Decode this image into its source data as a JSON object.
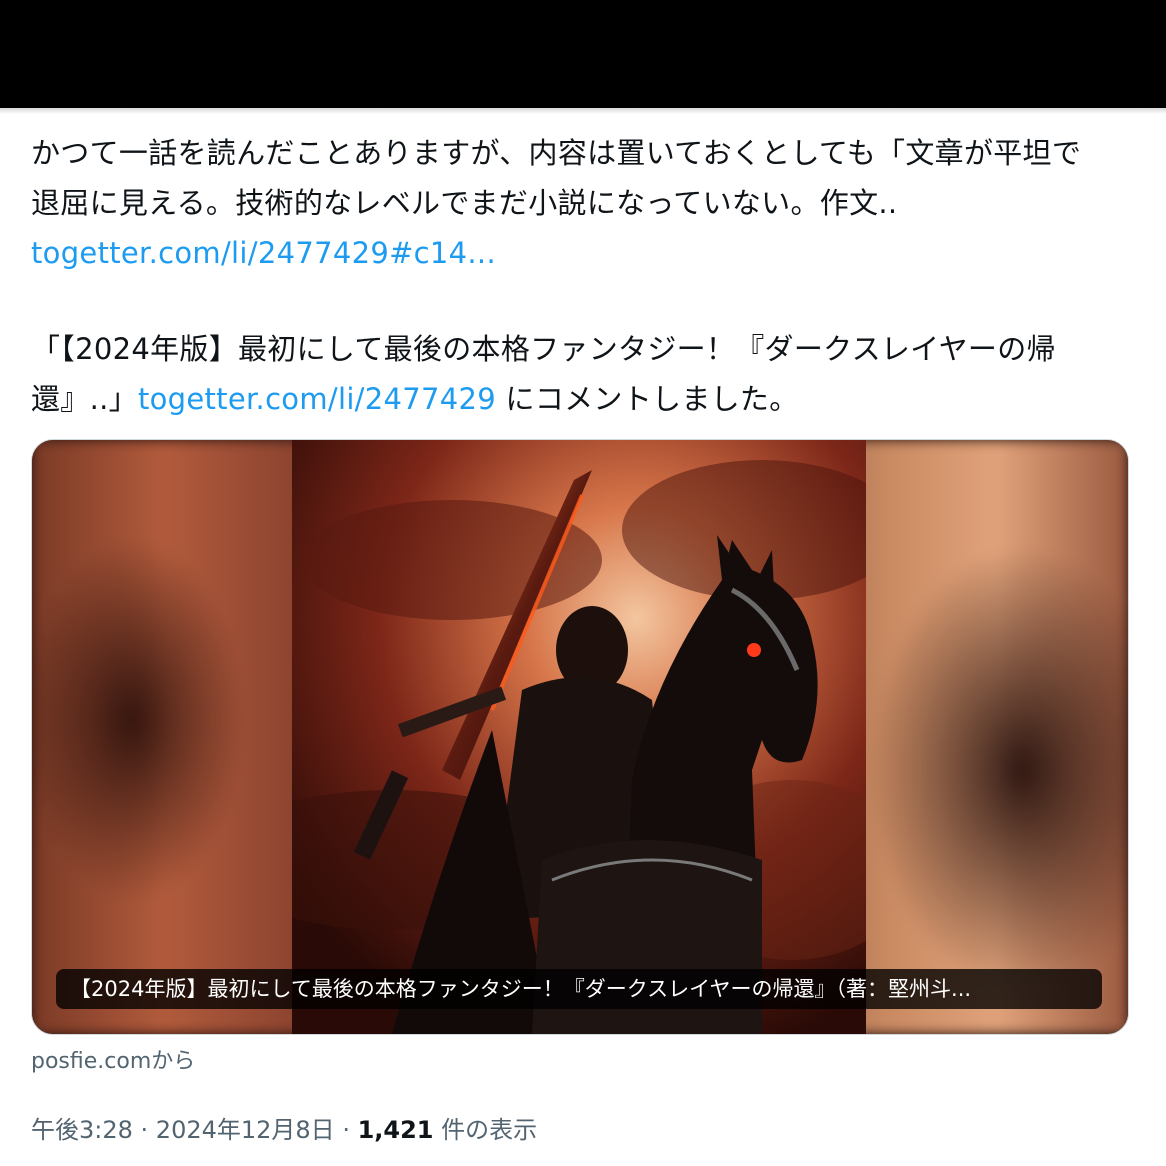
{
  "tweet": {
    "line1": "かつて一話を読んだことありますが、内容は置いておくとしても「文章が平坦で",
    "line2": "退屈に見える。技術的なレベルでまだ小説になっていない。作文..",
    "link1": "togetter.com/li/2477429#c14...",
    "line3": "「【2024年版】最初にして最後の本格ファンタジー！『ダークスレイヤーの帰",
    "line4_pre": "還』..」",
    "link2": "togetter.com/li/2477429",
    "line4_post": " にコメントしました。"
  },
  "card": {
    "caption": "【2024年版】最初にして最後の本格ファンタジー！『ダークスレイヤーの帰還』（著：堅州斗...",
    "source": "posfie.comから"
  },
  "meta": {
    "time": "午後3:28",
    "sep1": " · ",
    "date": "2024年12月8日",
    "sep2": " · ",
    "views": "1,421",
    "views_label": " 件の表示"
  },
  "colors": {
    "link": "#1d9bf0",
    "secondary": "#536471",
    "text": "#0f1419"
  }
}
